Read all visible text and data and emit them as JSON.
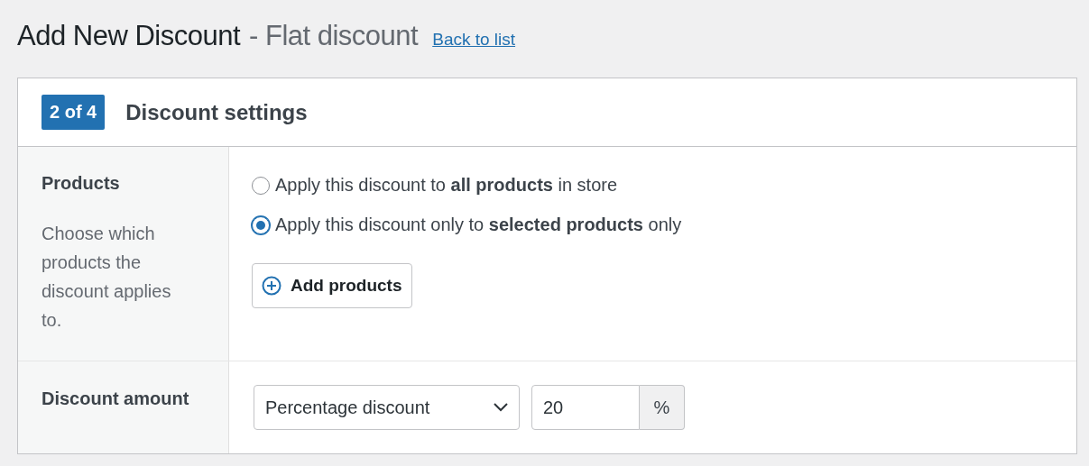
{
  "page": {
    "title": "Add New Discount",
    "subtitle": "- Flat discount",
    "back_link": "Back to list"
  },
  "card": {
    "step": "2 of 4",
    "title": "Discount settings"
  },
  "products": {
    "label": "Products",
    "description": "Choose which products the discount applies to.",
    "options": [
      {
        "text": "Apply this discount to **all products** in store",
        "selected": false
      },
      {
        "text": "Apply this discount only to **selected products** only",
        "selected": true
      }
    ],
    "add_button": "Add products"
  },
  "amount": {
    "label": "Discount amount",
    "type": "Percentage discount",
    "value": "20",
    "unit": "%"
  }
}
